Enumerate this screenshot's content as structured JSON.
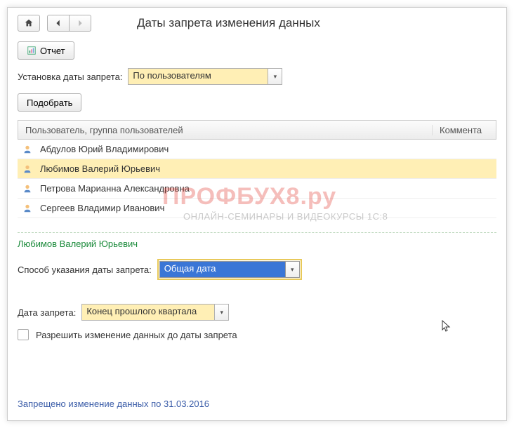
{
  "header": {
    "title": "Даты запрета изменения данных"
  },
  "toolbar": {
    "report_label": "Отчет"
  },
  "install_date": {
    "label": "Установка даты запрета:",
    "value": "По пользователям"
  },
  "pick_button": "Подобрать",
  "table": {
    "columns": {
      "user": "Пользователь, группа пользователей",
      "comment": "Коммента"
    },
    "rows": [
      {
        "name": "Абдулов Юрий Владимирович",
        "selected": false
      },
      {
        "name": "Любимов Валерий Юрьевич",
        "selected": true
      },
      {
        "name": "Петрова Марианна Александровна",
        "selected": false
      },
      {
        "name": "Сергеев Владимир Иванович",
        "selected": false
      }
    ]
  },
  "selected_user": "Любимов Валерий Юрьевич",
  "method": {
    "label": "Способ указания даты запрета:",
    "value": "Общая дата"
  },
  "ban_date": {
    "label": "Дата запрета:",
    "value": "Конец прошлого квартала"
  },
  "allow_edit": {
    "label": "Разрешить изменение данных до даты запрета",
    "checked": false
  },
  "footer": "Запрещено изменение данных по 31.03.2016",
  "watermark": {
    "main": "ПРОФБУХ8.ру",
    "sub": "ОНЛАЙН-СЕМИНАРЫ И ВИДЕОКУРСЫ 1С:8"
  }
}
